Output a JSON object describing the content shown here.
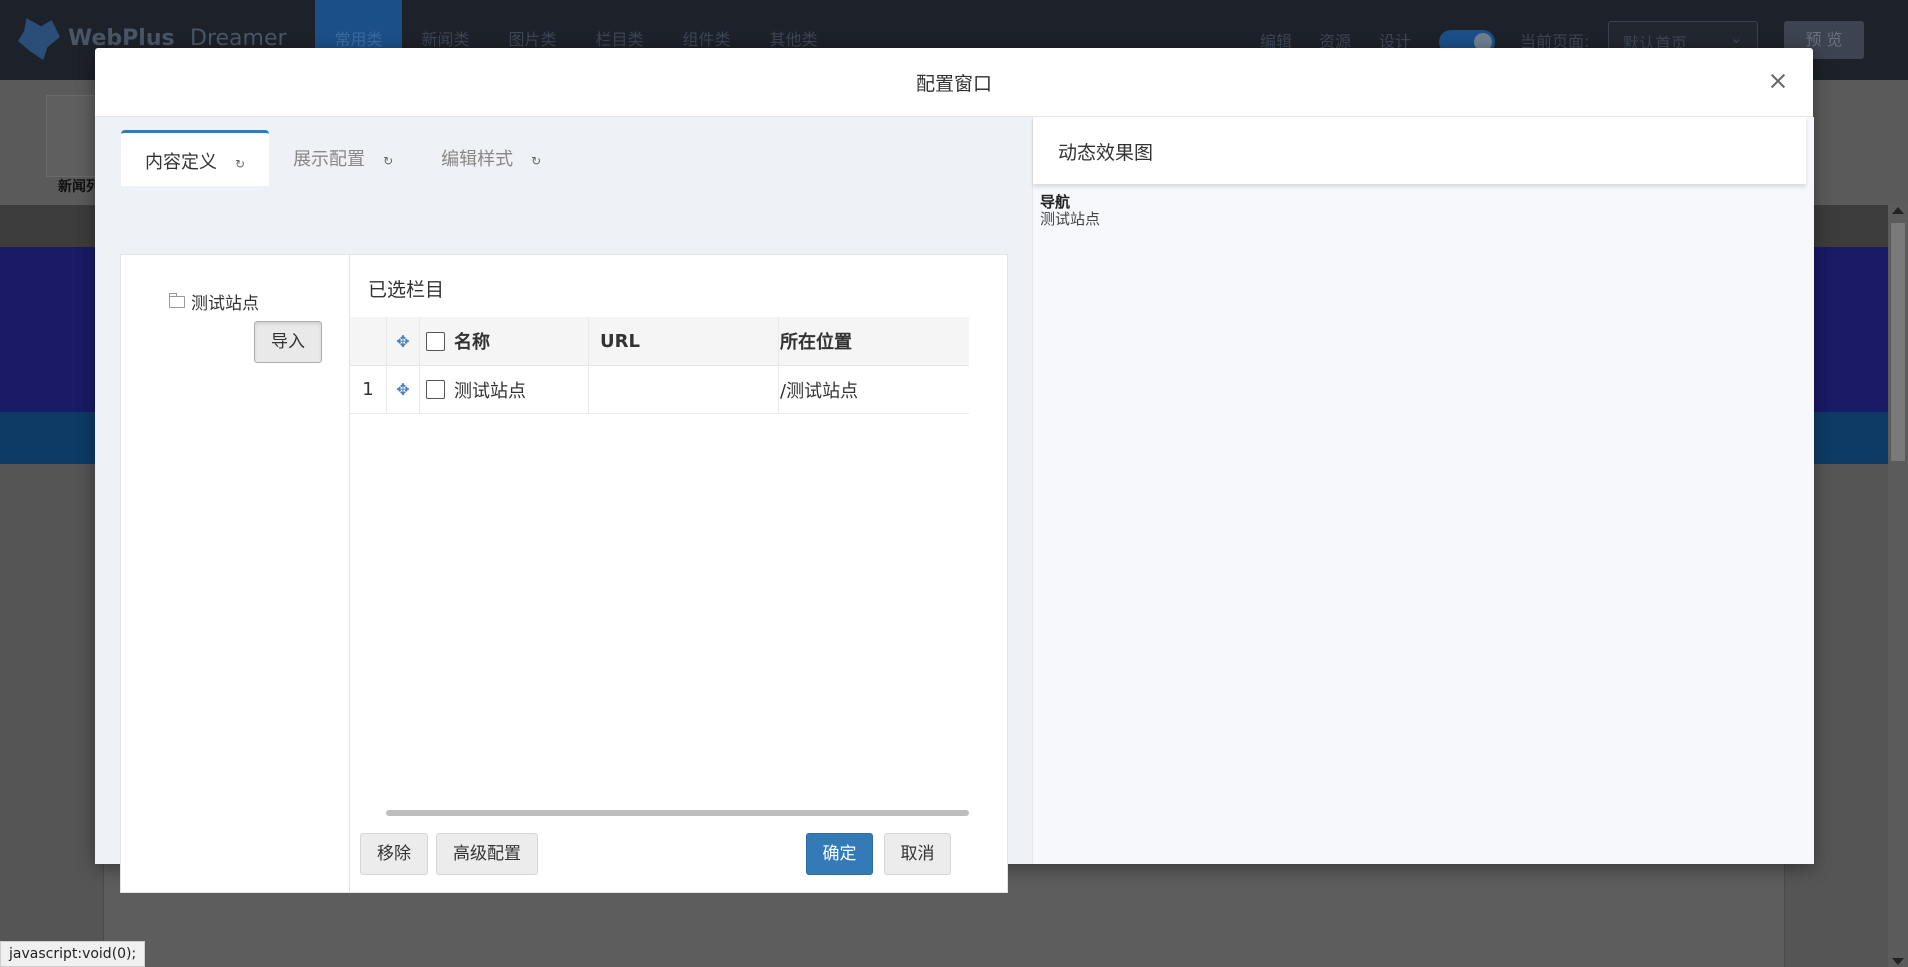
{
  "app": {
    "logo_text": "WebPlus",
    "logo_sub": "Dreamer",
    "categories": [
      "常用类",
      "新闻类",
      "图片类",
      "栏目类",
      "组件类",
      "其他类"
    ],
    "right_links": [
      "编辑",
      "资源",
      "设计"
    ],
    "current_page_label": "当前页面:",
    "current_page_value": "默认首页",
    "preview_label": "预 览",
    "component_label": "新闻列"
  },
  "modal": {
    "title": "配置窗口",
    "tabs": [
      {
        "label": "内容定义",
        "active": true
      },
      {
        "label": "展示配置",
        "active": false
      },
      {
        "label": "编辑样式",
        "active": false
      }
    ],
    "tree": {
      "node": "测试站点",
      "import_button": "导入"
    },
    "selected": {
      "title": "已选栏目",
      "columns": {
        "name": "名称",
        "url": "URL",
        "location": "所在位置"
      },
      "rows": [
        {
          "index": "1",
          "name": "测试站点",
          "url": "",
          "location": "/测试站点"
        }
      ]
    },
    "buttons": {
      "remove": "移除",
      "advanced": "高级配置",
      "confirm": "确定",
      "cancel": "取消"
    },
    "preview": {
      "title": "动态效果图",
      "nav_label": "导航",
      "site_label": "测试站点"
    }
  },
  "status_bar": "javascript:void(0);",
  "colors": {
    "accent": "#337ab7",
    "topbar": "#1d2129",
    "overlay": "#555555"
  }
}
